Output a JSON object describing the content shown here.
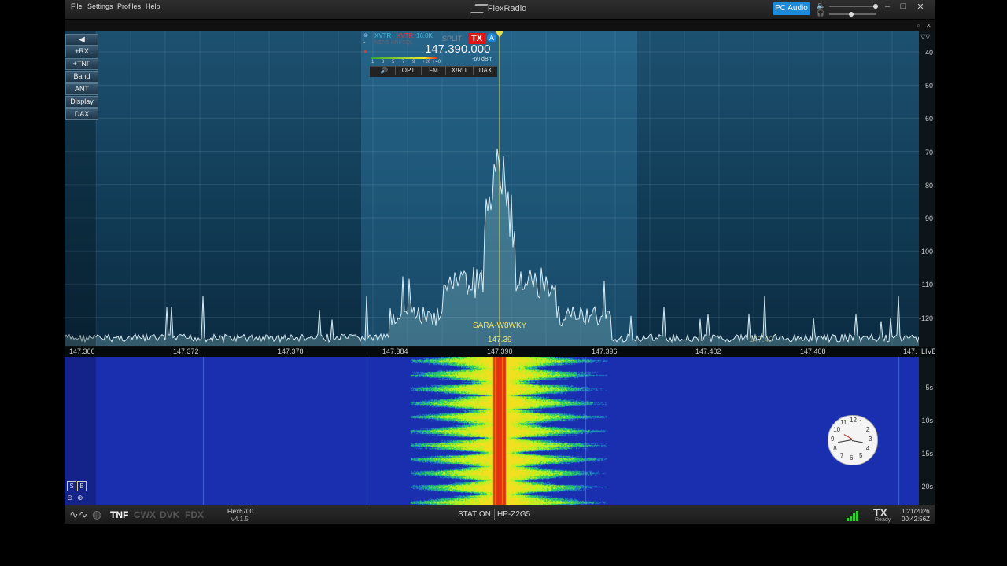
{
  "menu": [
    "File",
    "Settings",
    "Profiles",
    "Help"
  ],
  "app_title": "FlexRadio",
  "pc_audio_label": "PC Audio",
  "window_controls": {
    "minimize": "–",
    "maximize": "□",
    "close": "✕",
    "restore": "▫",
    "closepanel": "✕"
  },
  "side_buttons": [
    "+RX",
    "+TNF",
    "Band",
    "ANT",
    "Display",
    "DAX"
  ],
  "dbm_labels": [
    "-40",
    "-50",
    "-60",
    "-70",
    "-80",
    "-90",
    "-100",
    "-110",
    "-120"
  ],
  "freq_ticks": [
    "147.366",
    "147.372",
    "147.378",
    "147.384",
    "147.390",
    "147.396",
    "147.402",
    "147.408",
    "147."
  ],
  "live_label": "LIVE",
  "wf_labels": [
    "-5s",
    "-10s",
    "-15s",
    "-20s"
  ],
  "slice": {
    "xvtr_a": "XVTR",
    "xvtr_b": "XVTR",
    "bandwidth": "16.0K",
    "sub": "NENS ANFSQL",
    "split": "SPLIT",
    "tx": "TX",
    "letter": "A",
    "frequency": "147.390.000",
    "meter_scale": [
      "1",
      "3",
      "5",
      "7",
      "9",
      "+20",
      "+40"
    ],
    "level": "-60 dBm",
    "buttons": [
      "OPT",
      "FM",
      "X/RIT",
      "DAX"
    ]
  },
  "spot": {
    "callsign": "SARA-W8WKY",
    "freq": "147.39",
    "ghost": "147.40"
  },
  "status": {
    "tnf": "TNF",
    "cwx": "CWX",
    "dvk": "DVK",
    "fdx": "FDX",
    "model": "Flex6700",
    "version": "v4.1.5",
    "station_label": "STATION:",
    "station": "HP-Z2G5",
    "tx": "TX",
    "tx_state": "Ready",
    "date": "1/21/2026",
    "time": "00:42:56Z"
  },
  "sb_buttons": [
    "S",
    "B"
  ],
  "clock_numbers": [
    "12",
    "1",
    "2",
    "3",
    "4",
    "5",
    "6",
    "7",
    "8",
    "9",
    "10",
    "11"
  ],
  "colors": {
    "accent": "#1f8ad8",
    "tx_red": "#e01515",
    "tnf_white": "#ffffff",
    "spot_yellow": "#f1e36b",
    "trace": "#d8ecf4"
  }
}
